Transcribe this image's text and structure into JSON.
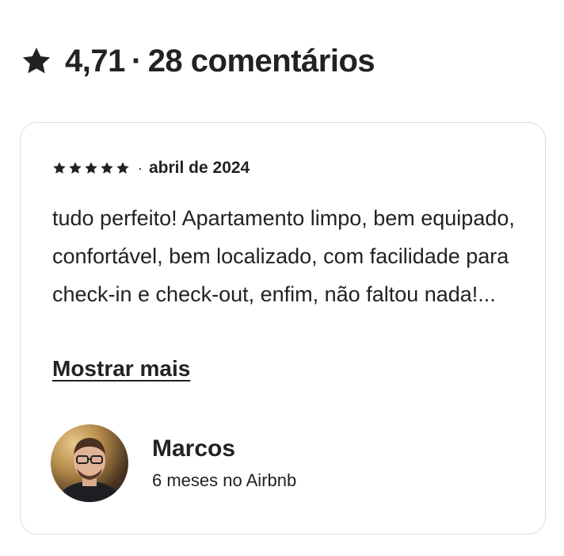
{
  "summary": {
    "rating": "4,71",
    "separator": "·",
    "count_label": "28 comentários",
    "icon": "star-icon"
  },
  "review": {
    "stars": 5,
    "separator": "·",
    "date": "abril de 2024",
    "text": "tudo perfeito! Apartamento limpo, bem equipado, confortável, bem localizado, com facilidade para check-in e check-out, enfim, não faltou nada!...",
    "show_more_label": "Mostrar mais",
    "reviewer": {
      "name": "Marcos",
      "tenure": "6 meses no Airbnb"
    }
  },
  "colors": {
    "text": "#222222",
    "card_border": "#dddddd",
    "background": "#ffffff"
  }
}
